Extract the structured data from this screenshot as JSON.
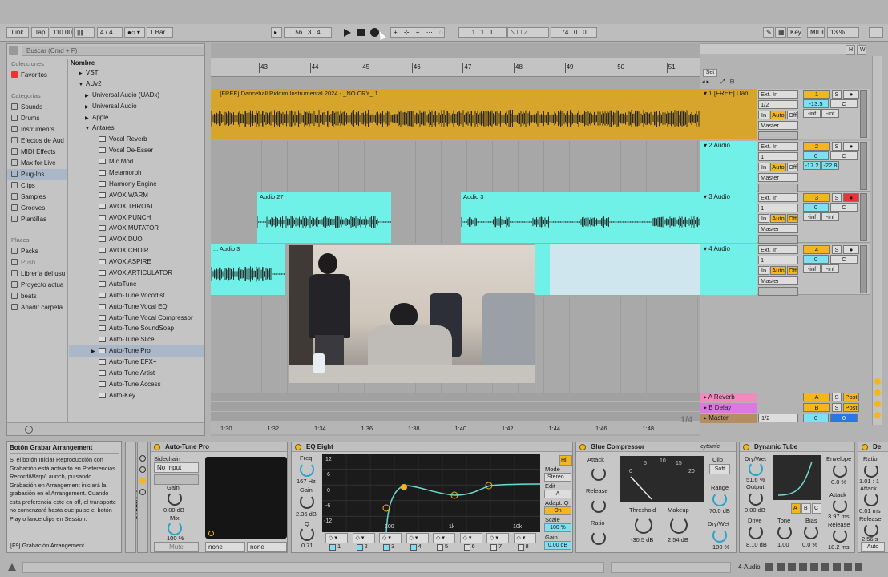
{
  "transport": {
    "link": "Link",
    "tap": "Tap",
    "tempo": "110.00",
    "sig": "4 / 4",
    "metro": "1 Bar",
    "position": "56 .  3 .  4",
    "loop_start": "1 .  1 .  1",
    "loop_len": "74 .  0 .  0",
    "key": "Key",
    "midi": "MIDI",
    "cpu": "13 %"
  },
  "browser": {
    "search_placeholder": "Buscar (Cmd + F)",
    "colecciones_title": "Colecciones",
    "favoritos": "Favoritos",
    "categorias_title": "Categorías",
    "categories": [
      "Sounds",
      "Drums",
      "Instruments",
      "Efectos de Aud",
      "MIDI Effects",
      "Max for Live",
      "Plug-Ins",
      "Clips",
      "Samples",
      "Grooves",
      "Plantillas"
    ],
    "places_title": "Places",
    "places": [
      "Packs",
      "Push",
      "Librería del usu",
      "Proyecto actua",
      "beats",
      "Añadir carpeta..."
    ],
    "col_header": "Nombre",
    "items": [
      "VST",
      "AUv2",
      "Universal Audio (UADx)",
      "Universal Audio",
      "Apple",
      "Antares",
      "Vocal Reverb",
      "Vocal De-Esser",
      "Mic Mod",
      "Metamorph",
      "Harmony Engine",
      "AVOX WARM",
      "AVOX THROAT",
      "AVOX PUNCH",
      "AVOX MUTATOR",
      "AVOX DUO",
      "AVOX CHOIR",
      "AVOX ASPIRE",
      "AVOX ARTICULATOR",
      "AutoTune",
      "Auto-Tune Vocodist",
      "Auto-Tune Vocal EQ",
      "Auto-Tune Vocal Compressor",
      "Auto-Tune SoundSoap",
      "Auto-Tune Slice",
      "Auto-Tune Pro",
      "Auto-Tune EFX+",
      "Auto-Tune Artist",
      "Auto-Tune Access",
      "Auto-Key"
    ]
  },
  "timeline": {
    "bars": [
      "43",
      "44",
      "45",
      "46",
      "47",
      "48",
      "49",
      "50",
      "51"
    ],
    "times": [
      "1:30",
      "1:32",
      "1:34",
      "1:36",
      "1:38",
      "1:40",
      "1:42",
      "1:44",
      "1:46",
      "1:48"
    ],
    "set_label": "Set",
    "zoom_label": "1/4"
  },
  "clips": {
    "c1": "... [FREE] Dancehall Riddim Instrumental 2024 - _NO CRY_ 1",
    "c2": "Audio 27",
    "c3": "Audio 3",
    "c4": "... Audio 3"
  },
  "tracks": [
    {
      "name": "1 [FREE] Dan",
      "input": "Ext. In",
      "ch": "1/2",
      "mon_in": "In",
      "mon_auto": "Auto",
      "mon_off": "Off",
      "out": "Master",
      "num": "1",
      "vol": "-13.5",
      "pan": "C",
      "peak1": "-inf",
      "peak2": "-inf",
      "color": "#d8a52c"
    },
    {
      "name": "2 Audio",
      "input": "Ext. In",
      "ch": "1",
      "mon_in": "In",
      "mon_auto": "Auto",
      "mon_off": "Off",
      "out": "Master",
      "num": "2",
      "vol": "0",
      "pan": "C",
      "peak1": "-17.2",
      "peak2": "-22.8",
      "color": "#70f0e6"
    },
    {
      "name": "3 Audio",
      "input": "Ext. In",
      "ch": "1",
      "mon_in": "In",
      "mon_auto": "Auto",
      "mon_off": "Off",
      "out": "Master",
      "num": "3",
      "vol": "0",
      "pan": "C",
      "peak1": "-inf",
      "peak2": "-inf",
      "color": "#70f0e6"
    },
    {
      "name": "4 Audio",
      "input": "Ext. In",
      "ch": "1",
      "mon_in": "In",
      "mon_auto": "Auto",
      "mon_off": "Off",
      "out": "Master",
      "num": "4",
      "vol": "0",
      "pan": "C",
      "peak1": "-inf",
      "peak2": "-inf",
      "color": "#70f0e6"
    }
  ],
  "returns": {
    "a": "A Reverb",
    "b": "B Delay",
    "master": "Master",
    "a_btn": "A",
    "b_btn": "B",
    "post": "Post",
    "s": "S",
    "master_ch": "1/2",
    "master_vol": "0",
    "master_pan": "0"
  },
  "info": {
    "title": "Botón Grabar Arrangement",
    "body": "Si el botón Iniciar Reproducción con Grabación está activado en Preferencias Record/Warp/Launch, pulsando Grabación en Arrangement iniciará la grabación en el Arrangement. Cuando esta preferencia este en off, el transporte no comenzará hasta que pulse el botón Play o lance clips en Session.",
    "shortcut": "[F9] Grabación Arrangement"
  },
  "devices": {
    "rack": "CADENA V...",
    "autotune": {
      "title": "Auto-Tune Pro",
      "sidechain": "Sidechain",
      "no_input": "No Input",
      "gain": "Gain",
      "gain_val": "0.00 dB",
      "mix": "Mix",
      "mix_val": "100 %",
      "mute": "Mute",
      "none1": "none",
      "none2": "none"
    },
    "eq": {
      "title": "EQ Eight",
      "freq": "Freq",
      "freq_val": "167 Hz",
      "gain": "Gain",
      "gain_val": "2.36 dB",
      "q": "Q",
      "q_val": "0.71",
      "db_ticks": [
        "12",
        "6",
        "0",
        "-6",
        "-12"
      ],
      "hz_ticks": [
        "100",
        "1k",
        "10k"
      ],
      "mode": "Mode",
      "mode_val": "Stereo",
      "edit": "Edit",
      "edit_val": "A",
      "adapt": "Adapt. Q",
      "adapt_val": "On",
      "scale": "Scale",
      "scale_val": "100 %",
      "out_gain": "Gain",
      "out_gain_val": "0.00 dB",
      "hi": "Hi",
      "bands": [
        "1",
        "2",
        "3",
        "4",
        "5",
        "6",
        "7",
        "8"
      ]
    },
    "glue": {
      "title": "Glue Compressor",
      "brand": "cytomic",
      "attack": "Attack",
      "release": "Release",
      "ratio": "Ratio",
      "threshold": "Threshold",
      "thr_val": "-30.5 dB",
      "makeup": "Makeup",
      "mk_val": "2.54 dB",
      "clip": "Clip",
      "soft": "Soft",
      "range": "Range",
      "range_val": "70.0 dB",
      "drywet": "Dry/Wet",
      "dw_val": "100 %",
      "att_ticks": [
        "1",
        "3",
        "10",
        "30",
        ".3",
        ".1",
        "0.01"
      ],
      "meter": [
        "0",
        "5",
        "10",
        "15",
        "20"
      ]
    },
    "tube": {
      "title": "Dynamic Tube",
      "drywet": "Dry/Wet",
      "dw_val": "51.6 %",
      "output": "Output",
      "out_val": "0.00 dB",
      "drive": "Drive",
      "drive_val": "8.10 dB",
      "tone": "Tone",
      "tone_val": "1.00",
      "bias": "Bias",
      "bias_val": "0.0 %",
      "envelope": "Envelope",
      "env_val": "0.0 %",
      "attack": "Attack",
      "att_val": "3.97 ms",
      "release": "Release",
      "rel_val": "18.2 ms",
      "abc": [
        "A",
        "B",
        "C"
      ]
    },
    "extra": {
      "title": "De",
      "ratio": "Ratio",
      "ratio_val": "1.01 : 1",
      "attack": "Attack",
      "att_val": "0.01 ms",
      "release": "Release",
      "rel_val": "2.56 s",
      "auto": "Auto"
    }
  },
  "status": {
    "track": "4-Audio"
  }
}
